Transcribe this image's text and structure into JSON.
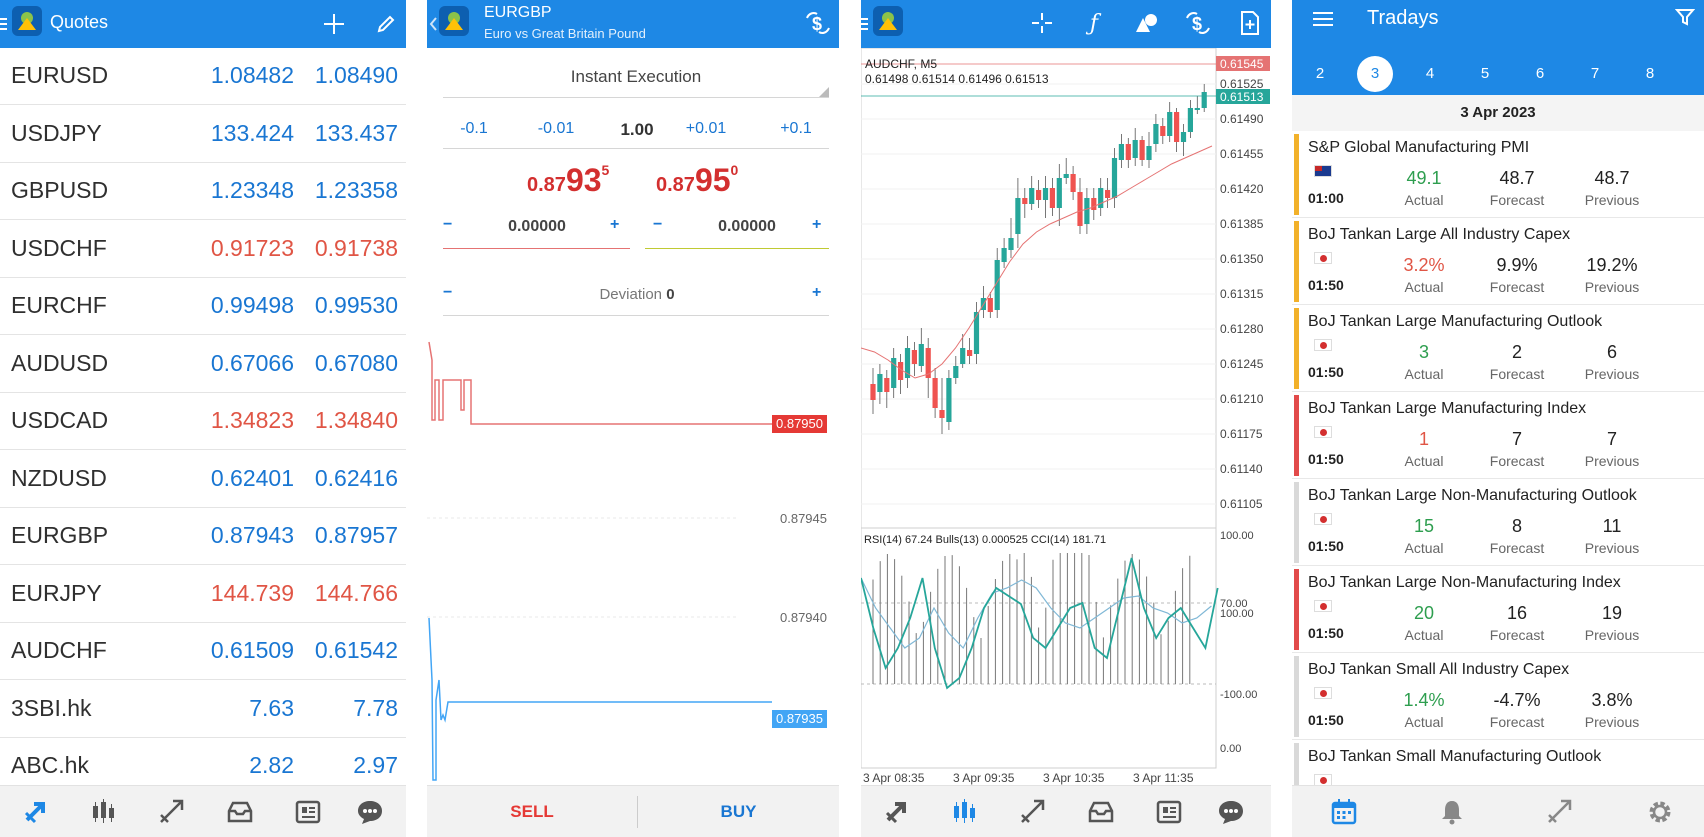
{
  "quotes": {
    "title": "Quotes",
    "rows": [
      {
        "symbol": "EURUSD",
        "bid": "1.08482",
        "ask": "1.08490",
        "color": "blue"
      },
      {
        "symbol": "USDJPY",
        "bid": "133.424",
        "ask": "133.437",
        "color": "blue"
      },
      {
        "symbol": "GBPUSD",
        "bid": "1.23348",
        "ask": "1.23358",
        "color": "blue"
      },
      {
        "symbol": "USDCHF",
        "bid": "0.91723",
        "ask": "0.91738",
        "color": "red"
      },
      {
        "symbol": "EURCHF",
        "bid": "0.99498",
        "ask": "0.99530",
        "color": "blue"
      },
      {
        "symbol": "AUDUSD",
        "bid": "0.67066",
        "ask": "0.67080",
        "color": "blue"
      },
      {
        "symbol": "USDCAD",
        "bid": "1.34823",
        "ask": "1.34840",
        "color": "red"
      },
      {
        "symbol": "NZDUSD",
        "bid": "0.62401",
        "ask": "0.62416",
        "color": "blue"
      },
      {
        "symbol": "EURGBP",
        "bid": "0.87943",
        "ask": "0.87957",
        "color": "blue"
      },
      {
        "symbol": "EURJPY",
        "bid": "144.739",
        "ask": "144.766",
        "color": "red"
      },
      {
        "symbol": "AUDCHF",
        "bid": "0.61509",
        "ask": "0.61542",
        "color": "blue"
      },
      {
        "symbol": "3SBI.hk",
        "bid": "7.63",
        "ask": "7.78",
        "color": "blue"
      },
      {
        "symbol": "ABC.hk",
        "bid": "2.82",
        "ask": "2.97",
        "color": "blue"
      }
    ]
  },
  "trade": {
    "symbol": "EURGBP",
    "description": "Euro vs Great Britain Pound",
    "execution": "Instant Execution",
    "steps": [
      "-0.1",
      "-0.01",
      "1.00",
      "+0.01",
      "+0.1"
    ],
    "sell_price": {
      "big": "0.87",
      "main": "93",
      "sup": "5"
    },
    "buy_price": {
      "big": "0.87",
      "main": "95",
      "sup": "0"
    },
    "sl_value": "0.00000",
    "tp_value": "0.00000",
    "deviation_label": "Deviation",
    "deviation_value": "0",
    "ask_tag": "0.87950",
    "bid_tag": "0.87935",
    "levels": [
      "0.87945",
      "0.87940"
    ],
    "sell_label": "SELL",
    "buy_label": "BUY"
  },
  "chart": {
    "symbol_tf": "AUDCHF, M5",
    "ohlc": "0.61498 0.61514 0.61496 0.61513",
    "ask_tag": "0.61545",
    "bid_tag": "0.61513",
    "price_axis": [
      "0.61525",
      "0.61490",
      "0.61455",
      "0.61420",
      "0.61385",
      "0.61350",
      "0.61315",
      "0.61280",
      "0.61245",
      "0.61210",
      "0.61175",
      "0.61140",
      "0.61105"
    ],
    "indicator_label": "RSI(14) 67.24 Bulls(13) 0.000525 CCI(14) 181.71",
    "ind_axis": [
      "100.00",
      "70.00",
      "100.00",
      "-100.00",
      "0.00"
    ],
    "time_axis": [
      "3 Apr 08:35",
      "3 Apr 09:35",
      "3 Apr 10:35",
      "3 Apr 11:35"
    ]
  },
  "calendar": {
    "title": "Tradays",
    "days": [
      "2",
      "3",
      "4",
      "5",
      "6",
      "7",
      "8"
    ],
    "selected_day": "3",
    "date": "3 Apr 2023",
    "labels": {
      "actual": "Actual",
      "forecast": "Forecast",
      "previous": "Previous"
    },
    "events": [
      {
        "name": "S&P Global Manufacturing PMI",
        "time": "01:00",
        "actual": "49.1",
        "forecast": "48.7",
        "previous": "48.7",
        "impact": "#f2b12a",
        "actual_color": "#2e9e4f",
        "flag": "au"
      },
      {
        "name": "BoJ Tankan Large All Industry Capex",
        "time": "01:50",
        "actual": "3.2%",
        "forecast": "9.9%",
        "previous": "19.2%",
        "impact": "#f2b12a",
        "actual_color": "#e05545",
        "flag": "jp"
      },
      {
        "name": "BoJ Tankan Large Manufacturing Outlook",
        "time": "01:50",
        "actual": "3",
        "forecast": "2",
        "previous": "6",
        "impact": "#f2b12a",
        "actual_color": "#2e9e4f",
        "flag": "jp"
      },
      {
        "name": "BoJ Tankan Large Manufacturing Index",
        "time": "01:50",
        "actual": "1",
        "forecast": "7",
        "previous": "7",
        "impact": "#e24a4a",
        "actual_color": "#e05545",
        "flag": "jp"
      },
      {
        "name": "BoJ Tankan Large Non-Manufacturing Outlook",
        "time": "01:50",
        "actual": "15",
        "forecast": "8",
        "previous": "11",
        "impact": "#d9d9d9",
        "actual_color": "#2e9e4f",
        "flag": "jp"
      },
      {
        "name": "BoJ Tankan Large Non-Manufacturing Index",
        "time": "01:50",
        "actual": "20",
        "forecast": "16",
        "previous": "19",
        "impact": "#e24a4a",
        "actual_color": "#2e9e4f",
        "flag": "jp"
      },
      {
        "name": "BoJ Tankan Small All Industry Capex",
        "time": "01:50",
        "actual": "1.4%",
        "forecast": "-4.7%",
        "previous": "3.8%",
        "impact": "#d9d9d9",
        "actual_color": "#2e9e4f",
        "flag": "jp"
      },
      {
        "name": "BoJ Tankan Small Manufacturing Outlook",
        "time": "",
        "actual": "",
        "forecast": "",
        "previous": "",
        "impact": "#d9d9d9",
        "actual_color": "#2e9e4f",
        "flag": "jp"
      }
    ]
  },
  "colors": {
    "accent": "#1e88e5",
    "bull": "#26a69a",
    "bear": "#ef5350",
    "sell": "#e53935",
    "buy": "#1976d2"
  },
  "icons": {
    "quotes_bar": [
      "menu-icon",
      "app-logo-icon",
      "plus-icon",
      "pencil-icon"
    ],
    "trade_bar": [
      "back-icon",
      "app-logo-icon",
      "dollar-exchange-icon"
    ],
    "chart_bar": [
      "menu-icon",
      "app-logo-icon",
      "crosshair-icon",
      "function-icon",
      "shapes-icon",
      "dollar-exchange-icon",
      "add-document-icon"
    ],
    "bottom_nav": [
      "quotes-tab-icon",
      "chart-tab-icon",
      "trade-tab-icon",
      "history-tab-icon",
      "news-tab-icon",
      "chat-tab-icon"
    ],
    "calendar_bar": [
      "menu-icon",
      "filter-icon"
    ],
    "calendar_nav": [
      "calendar-tab-icon",
      "bell-tab-icon",
      "trade-tab-icon",
      "settings-tab-icon"
    ]
  }
}
